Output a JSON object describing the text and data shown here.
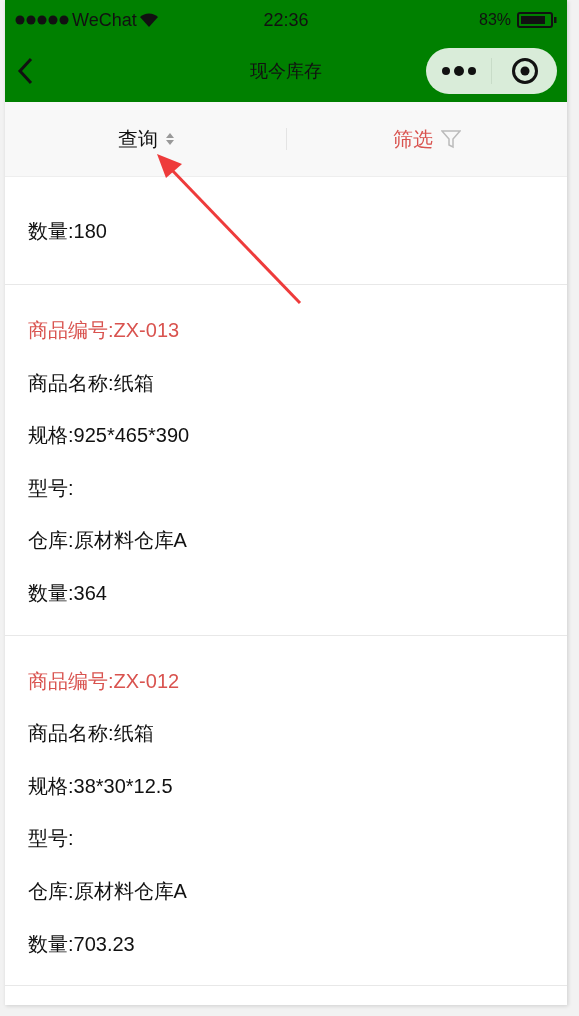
{
  "status_bar": {
    "carrier": "WeChat",
    "time": "22:36",
    "battery": "83%"
  },
  "nav_bar": {
    "title": "现今库存"
  },
  "filter_bar": [
    {
      "label": "查询",
      "kind": "sort",
      "selected": false
    },
    {
      "label": "筛选",
      "kind": "filter",
      "selected": true
    }
  ],
  "items": [
    {
      "fields": [
        "数量:180"
      ]
    },
    {
      "code": "商品编号:ZX-013",
      "fields": [
        "商品名称:纸箱",
        "规格:925*465*390",
        "型号:",
        "仓库:原材料仓库A",
        "数量:364"
      ]
    },
    {
      "code": "商品编号:ZX-012",
      "fields": [
        "商品名称:纸箱",
        "规格:38*30*12.5",
        "型号:",
        "仓库:原材料仓库A",
        "数量:703.23"
      ]
    }
  ]
}
